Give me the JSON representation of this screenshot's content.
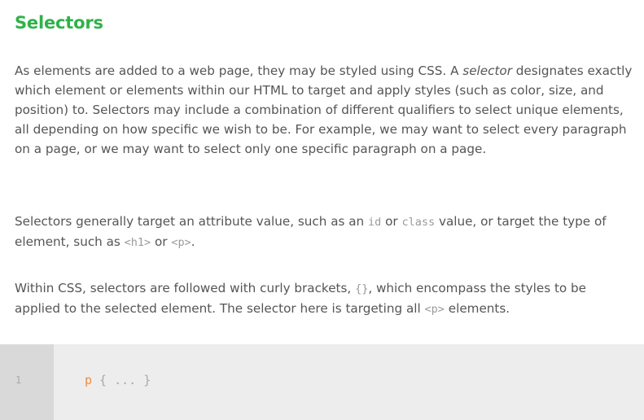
{
  "section": {
    "title": "Selectors"
  },
  "paragraph1": {
    "text_before": "As elements are added to a web page, they may be styled using CSS. A ",
    "emphasis": "selector",
    "text_after": " designates exactly which element or elements within our HTML to target and apply styles (such as color, size, and position) to. Selectors may include a combination of different qualifiers to select unique elements, all depending on how specific we wish to be. For example, we may want to select every paragraph on a page, or we may want to select only one specific paragraph on a page."
  },
  "paragraph2": {
    "part1": "Selectors generally target an attribute value, such as an ",
    "code1": "id",
    "part2": " or ",
    "code2": "class",
    "part3": " value, or target the type of element, such as ",
    "code3": "<h1>",
    "part4": " or ",
    "code4": "<p>",
    "part5": "."
  },
  "paragraph3": {
    "part1": "Within CSS, selectors are followed with curly brackets, ",
    "code1": "{}",
    "part2": ", which encompass the styles to be applied to the selected element. The selector here is targeting all ",
    "code2": "<p>",
    "part3": " elements."
  },
  "code_block": {
    "line_number": "1",
    "selector": "p",
    "rest": " { ... }",
    "colors": {
      "background": "#ededed",
      "gutter": "#d9d9d9",
      "selector": "#f08d3c",
      "text": "#a8a8a8"
    }
  },
  "colors": {
    "heading": "#2fb24a",
    "body_text": "#555555",
    "inline_code": "#9a9a9a"
  }
}
